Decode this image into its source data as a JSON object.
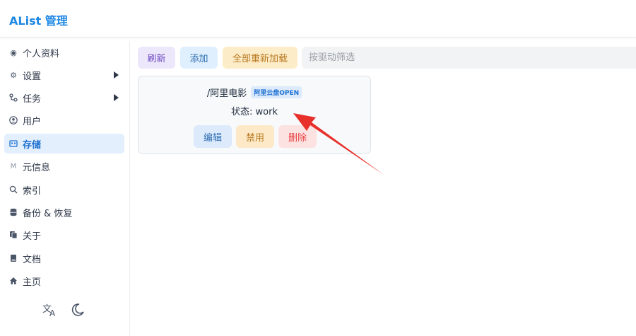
{
  "header": {
    "title": "AList 管理"
  },
  "sidebar": {
    "items": [
      {
        "label": "个人资料",
        "icon": "profile-icon"
      },
      {
        "label": "设置",
        "icon": "gear-icon",
        "expandable": true
      },
      {
        "label": "任务",
        "icon": "tasks-icon",
        "expandable": true
      },
      {
        "label": "用户",
        "icon": "user-icon"
      },
      {
        "label": "存储",
        "icon": "storage-icon",
        "active": true
      },
      {
        "label": "元信息",
        "icon": "meta-icon"
      },
      {
        "label": "索引",
        "icon": "search-icon"
      },
      {
        "label": "备份 & 恢复",
        "icon": "database-icon"
      },
      {
        "label": "关于",
        "icon": "about-icon"
      },
      {
        "label": "文档",
        "icon": "book-icon"
      },
      {
        "label": "主页",
        "icon": "home-icon"
      }
    ],
    "footer": {
      "language_icon": "translate-icon",
      "theme_icon": "moon-icon"
    }
  },
  "toolbar": {
    "refresh_label": "刷新",
    "add_label": "添加",
    "reload_all_label": "全部重新加载",
    "filter_placeholder": "按驱动筛选"
  },
  "storage_card": {
    "mount_path": "/阿里电影",
    "driver": "阿里云盘OPEN",
    "status": "状态: work",
    "edit_label": "编辑",
    "disable_label": "禁用",
    "delete_label": "删除"
  },
  "colors": {
    "accent": "#1e88e5",
    "active_bg": "#e3effd",
    "annotation_arrow": "#e8302a"
  }
}
